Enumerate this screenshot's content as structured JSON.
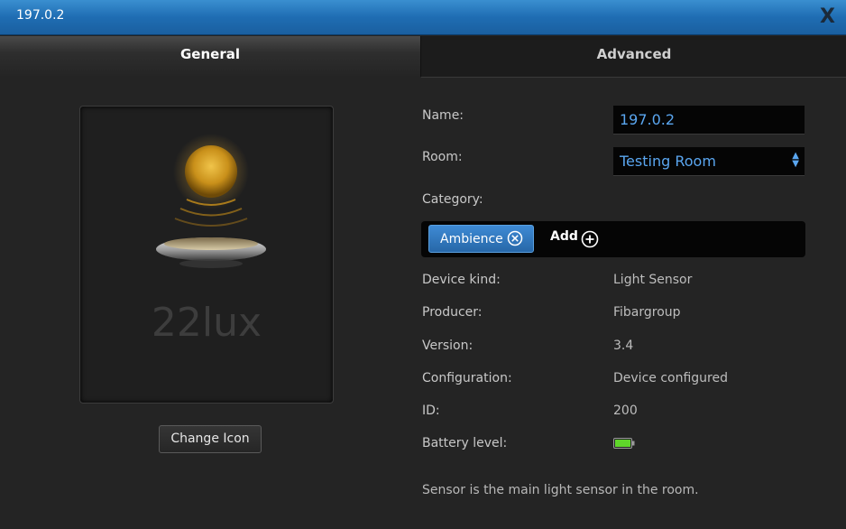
{
  "window": {
    "title": "197.0.2",
    "close_label": "X"
  },
  "tabs": [
    {
      "label": "General",
      "active": true
    },
    {
      "label": "Advanced",
      "active": false
    }
  ],
  "icon_panel": {
    "lux_text": "22lux",
    "icon": "light-sensor-sun-icon",
    "change_icon_label": "Change Icon"
  },
  "form": {
    "name_label": "Name:",
    "name_value": "197.0.2",
    "room_label": "Room:",
    "room_value": "Testing Room",
    "category_label": "Category:",
    "category_chip": "Ambience",
    "add_label": "Add"
  },
  "details": [
    {
      "label": "Device kind:",
      "value": "Light Sensor"
    },
    {
      "label": "Producer:",
      "value": "Fibargroup"
    },
    {
      "label": "Version:",
      "value": "3.4"
    },
    {
      "label": "Configuration:",
      "value": "Device configured"
    },
    {
      "label": "ID:",
      "value": "200"
    },
    {
      "label": "Battery level:",
      "value": ""
    }
  ],
  "battery": {
    "icon": "battery-full-icon",
    "color": "#5fd62a"
  },
  "note": "Sensor is the main light sensor in the room.",
  "colors": {
    "accent": "#2f78c2",
    "title_bar": "#1f6db3",
    "input_text": "#5aa6f0"
  }
}
